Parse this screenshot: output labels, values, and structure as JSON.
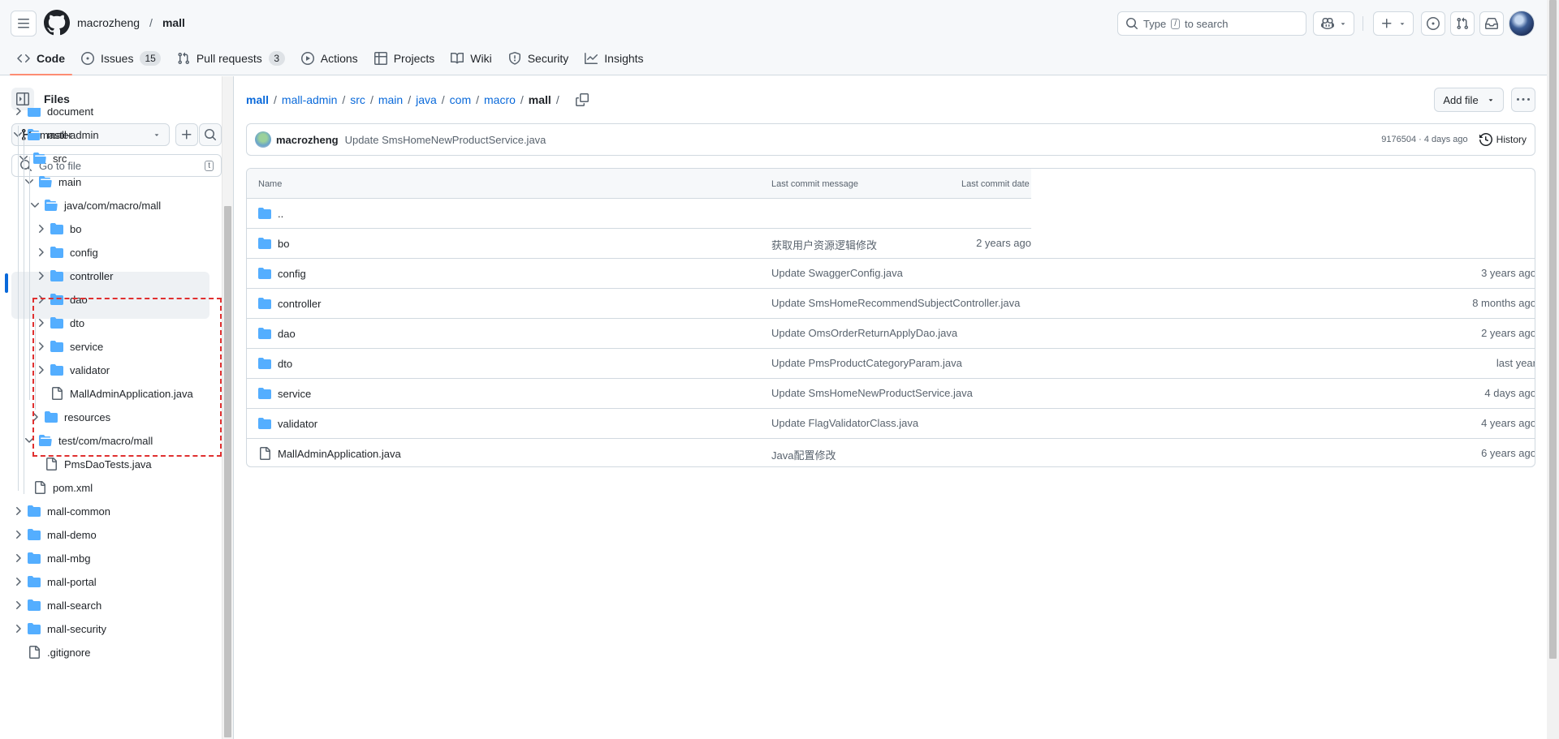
{
  "header": {
    "owner": "macrozheng",
    "separator": "/",
    "repo": "mall",
    "search_prefix": "Type",
    "search_key": "/",
    "search_suffix": "to search"
  },
  "tabs": [
    {
      "label": "Code",
      "icon": "code-icon"
    },
    {
      "label": "Issues",
      "icon": "issue-opened-icon",
      "count": "15"
    },
    {
      "label": "Pull requests",
      "icon": "git-pull-request-icon",
      "count": "3"
    },
    {
      "label": "Actions",
      "icon": "play-icon"
    },
    {
      "label": "Projects",
      "icon": "table-icon"
    },
    {
      "label": "Wiki",
      "icon": "book-icon"
    },
    {
      "label": "Security",
      "icon": "shield-icon"
    },
    {
      "label": "Insights",
      "icon": "graph-icon"
    }
  ],
  "sidebar": {
    "title": "Files",
    "branch": "master",
    "goto_placeholder": "Go to file",
    "goto_key": "t",
    "tree": [
      {
        "label": "document",
        "type": "folder",
        "expanded": false
      },
      {
        "label": "mall-admin",
        "type": "folder",
        "expanded": true
      },
      {
        "label": "src",
        "type": "folder",
        "expanded": true
      },
      {
        "label": "main",
        "type": "folder",
        "expanded": true
      },
      {
        "label": "java/com/macro/mall",
        "type": "folder",
        "expanded": true,
        "selected": true
      },
      {
        "label": "bo",
        "type": "folder",
        "expanded": false
      },
      {
        "label": "config",
        "type": "folder",
        "expanded": false
      },
      {
        "label": "controller",
        "type": "folder",
        "expanded": false
      },
      {
        "label": "dao",
        "type": "folder",
        "expanded": false
      },
      {
        "label": "dto",
        "type": "folder",
        "expanded": false
      },
      {
        "label": "service",
        "type": "folder",
        "expanded": false
      },
      {
        "label": "validator",
        "type": "folder",
        "expanded": false
      },
      {
        "label": "MallAdminApplication.java",
        "type": "file"
      },
      {
        "label": "resources",
        "type": "folder",
        "expanded": false
      },
      {
        "label": "test/com/macro/mall",
        "type": "folder",
        "expanded": true
      },
      {
        "label": "PmsDaoTests.java",
        "type": "file"
      },
      {
        "label": "pom.xml",
        "type": "file"
      },
      {
        "label": "mall-common",
        "type": "folder",
        "expanded": false
      },
      {
        "label": "mall-demo",
        "type": "folder",
        "expanded": false
      },
      {
        "label": "mall-mbg",
        "type": "folder",
        "expanded": false
      },
      {
        "label": "mall-portal",
        "type": "folder",
        "expanded": false
      },
      {
        "label": "mall-search",
        "type": "folder",
        "expanded": false
      },
      {
        "label": "mall-security",
        "type": "folder",
        "expanded": false
      },
      {
        "label": ".gitignore",
        "type": "file"
      }
    ]
  },
  "breadcrumb": {
    "parts": [
      "mall",
      "mall-admin",
      "src",
      "main",
      "java",
      "com",
      "macro"
    ],
    "current": "mall",
    "separator": "/"
  },
  "actions": {
    "add_file": "Add file"
  },
  "commit": {
    "author": "macrozheng",
    "message": "Update SmsHomeNewProductService.java",
    "meta": "9176504 · 4 days ago",
    "history": "History"
  },
  "table": {
    "headers": {
      "name": "Name",
      "message": "Last commit message",
      "date": "Last commit date"
    },
    "parent": "..",
    "rows": [
      {
        "name": "bo",
        "type": "folder",
        "message": "获取用户资源逻辑修改",
        "date": "2 years ago"
      },
      {
        "name": "config",
        "type": "folder",
        "message": "Update SwaggerConfig.java",
        "date": "3 years ago"
      },
      {
        "name": "controller",
        "type": "folder",
        "message": "Update SmsHomeRecommendSubjectController.java",
        "date": "8 months ago"
      },
      {
        "name": "dao",
        "type": "folder",
        "message": "Update OmsOrderReturnApplyDao.java",
        "date": "2 years ago"
      },
      {
        "name": "dto",
        "type": "folder",
        "message": "Update PmsProductCategoryParam.java",
        "date": "last year"
      },
      {
        "name": "service",
        "type": "folder",
        "message": "Update SmsHomeNewProductService.java",
        "date": "4 days ago"
      },
      {
        "name": "validator",
        "type": "folder",
        "message": "Update FlagValidatorClass.java",
        "date": "4 years ago"
      },
      {
        "name": "MallAdminApplication.java",
        "type": "file",
        "message": "Java配置修改",
        "date": "6 years ago"
      }
    ]
  },
  "colors": {
    "link": "#0969da",
    "folder": "#54aeff",
    "tab_underline": "#fd8c73",
    "highlight_box": "#e03030"
  }
}
